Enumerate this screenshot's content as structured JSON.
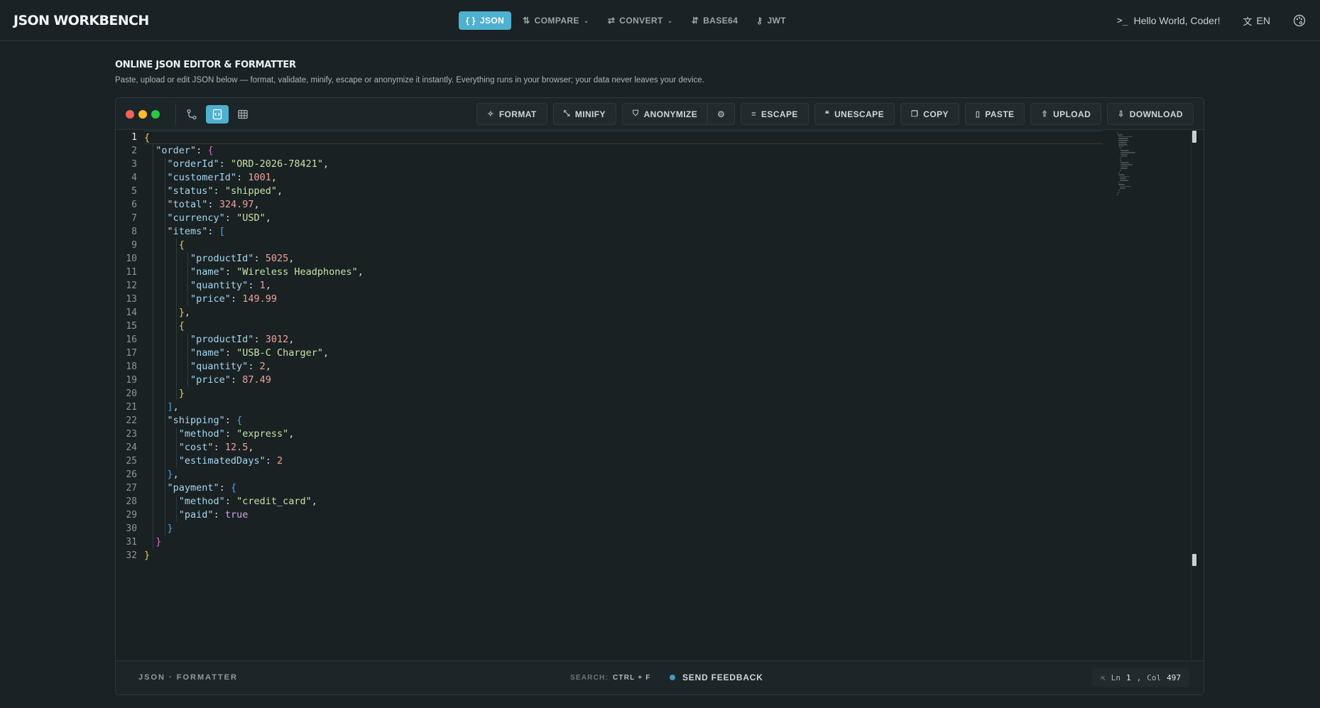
{
  "app": {
    "title": "JSON WORKBENCH"
  },
  "nav": [
    {
      "label": "JSON",
      "icon": "{ }",
      "active": true,
      "dropdown": false
    },
    {
      "label": "COMPARE",
      "icon": "⇅",
      "active": false,
      "dropdown": true
    },
    {
      "label": "CONVERT",
      "icon": "⇄",
      "active": false,
      "dropdown": true
    },
    {
      "label": "BASE64",
      "icon": "⇵",
      "active": false,
      "dropdown": false
    },
    {
      "label": "JWT",
      "icon": "⚷",
      "active": false,
      "dropdown": false
    }
  ],
  "topright": {
    "greeting": "Hello World, Coder!",
    "lang": "EN"
  },
  "page": {
    "title": "ONLINE JSON EDITOR & FORMATTER",
    "subtitle": "Paste, upload or edit JSON below — format, validate, minify, escape or anonymize it instantly. Everything runs in your browser; your data never leaves your device."
  },
  "toolbar": {
    "format": "FORMAT",
    "minify": "MINIFY",
    "anonymize": "ANONYMIZE",
    "escape": "ESCAPE",
    "unescape": "UNESCAPE",
    "copy": "COPY",
    "paste": "PASTE",
    "upload": "UPLOAD",
    "download": "DOWNLOAD"
  },
  "window_dots": [
    "#ff5f57",
    "#febc2e",
    "#28c840"
  ],
  "code_lines": [
    "{",
    "  \"order\": {",
    "    \"orderId\": \"ORD-2026-78421\",",
    "    \"customerId\": 1001,",
    "    \"status\": \"shipped\",",
    "    \"total\": 324.97,",
    "    \"currency\": \"USD\",",
    "    \"items\": [",
    "      {",
    "        \"productId\": 5025,",
    "        \"name\": \"Wireless Headphones\",",
    "        \"quantity\": 1,",
    "        \"price\": 149.99",
    "      },",
    "      {",
    "        \"productId\": 3012,",
    "        \"name\": \"USB-C Charger\",",
    "        \"quantity\": 2,",
    "        \"price\": 87.49",
    "      }",
    "    ],",
    "    \"shipping\": {",
    "      \"method\": \"express\",",
    "      \"cost\": 12.5,",
    "      \"estimatedDays\": 2",
    "    },",
    "    \"payment\": {",
    "      \"method\": \"credit_card\",",
    "      \"paid\": true",
    "    }",
    "  }",
    "}"
  ],
  "status": {
    "mode": "JSON · FORMATTER",
    "search_label": "SEARCH:",
    "search_key": "CTRL + F",
    "feedback": "SEND FEEDBACK",
    "ln_label": "Ln",
    "ln": "1",
    "col_label": "Col",
    "col": "497"
  }
}
